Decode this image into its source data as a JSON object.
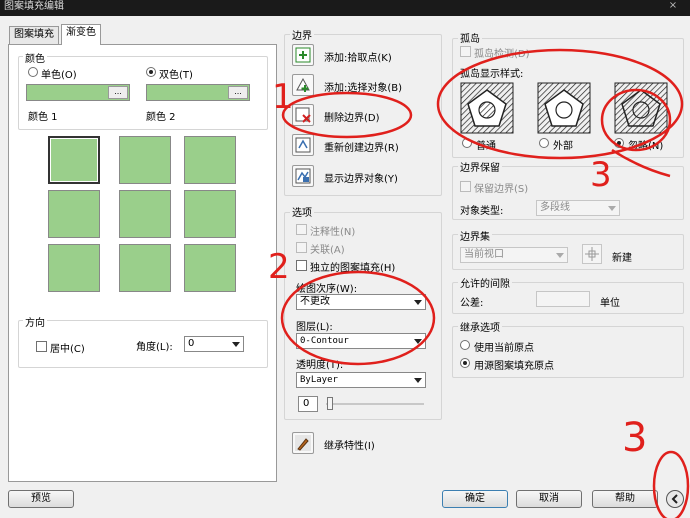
{
  "window": {
    "title": "图案填充编辑",
    "close_glyph": "×"
  },
  "tabs": [
    {
      "label": "图案填充"
    },
    {
      "label": "渐变色"
    }
  ],
  "color": {
    "label": "颜色",
    "single": "单色(O)",
    "double": "双色(T)",
    "color1": "颜色 1",
    "color2": "颜色 2",
    "browse": "...",
    "swatch": "#9acf8b"
  },
  "direction": {
    "label": "方向",
    "center": "居中(C)",
    "angle_label": "角度(L):",
    "angle_value": "0"
  },
  "boundary": {
    "label": "边界",
    "add_pick": "添加:拾取点(K)",
    "add_select": "添加:选择对象(B)",
    "remove": "删除边界(D)",
    "recreate": "重新创建边界(R)",
    "show": "显示边界对象(Y)"
  },
  "options": {
    "label": "选项",
    "annotative": "注释性(N)",
    "associative": "关联(A)",
    "independent": "独立的图案填充(H)",
    "draw_order_label": "绘图次序(W):",
    "draw_order_value": "不更改",
    "layer_label": "图层(L):",
    "layer_value": "0-Contour",
    "transparency_label": "透明度(T):",
    "transparency_value": "ByLayer",
    "transparency_number": "0"
  },
  "inherit_button": "继承特性(I)",
  "islands": {
    "label": "孤岛",
    "detect": "孤岛检测(D)",
    "style_label": "孤岛显示样式:",
    "normal": "普通",
    "outer": "外部",
    "ignore": "忽略(N)"
  },
  "retain": {
    "label": "边界保留",
    "retain_check": "保留边界(S)",
    "type_label": "对象类型:",
    "type_value": "多段线"
  },
  "boundary_set": {
    "label": "边界集",
    "value": "当前视口",
    "new": "新建"
  },
  "gap": {
    "label": "允许的间隙",
    "tolerance": "公差:",
    "unit": "单位"
  },
  "inherit_options": {
    "label": "继承选项",
    "use_current": "使用当前原点",
    "use_source": "用源图案填充原点"
  },
  "footer": {
    "preview": "预览",
    "ok": "确定",
    "cancel": "取消",
    "help": "帮助"
  },
  "annotations": {
    "mark1": "1",
    "mark2": "2",
    "mark3a": "3",
    "mark3b": "3"
  },
  "colors": {
    "annotation": "#e0201c",
    "swatch": "#9acf8b",
    "titlebar": "#1a1a1a"
  }
}
